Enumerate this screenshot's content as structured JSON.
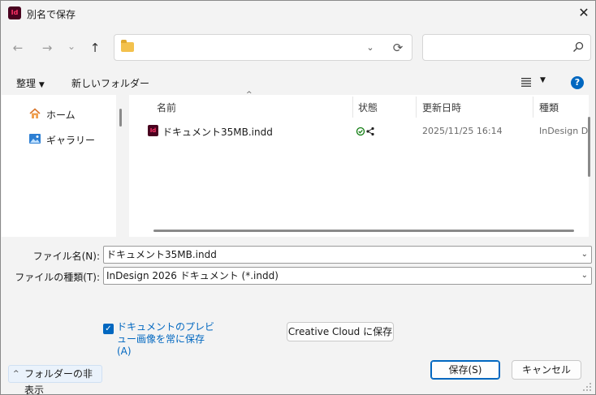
{
  "window": {
    "title": "別名で保存",
    "app_icon": "Id",
    "close_glyph": "✕"
  },
  "nav": {
    "back": "←",
    "forward": "→",
    "recent": "⌄",
    "up": "↑",
    "address_chevron": "⌄",
    "refresh": "⟳"
  },
  "toolbar": {
    "organize": "整理",
    "organize_caret": "▼",
    "new_folder": "新しいフォルダー",
    "view_caret": "▼",
    "help": "?"
  },
  "sidebar": {
    "items": [
      {
        "label": "ホーム",
        "icon": "home-icon"
      },
      {
        "label": "ギャラリー",
        "icon": "gallery-icon"
      }
    ]
  },
  "file_list": {
    "sort_glyph": "^",
    "columns": [
      "名前",
      "状態",
      "更新日時",
      "種類"
    ],
    "rows": [
      {
        "icon": "Id",
        "name": "ドキュメント35MB.indd",
        "modified": "2025/11/25 16:14",
        "type": "InDesign D"
      }
    ]
  },
  "form": {
    "filename_label": "ファイル名(N):",
    "filename_value": "ドキュメント35MB.indd",
    "filetype_label": "ファイルの種類(T):",
    "filetype_value": "InDesign 2026 ドキュメント (*.indd)",
    "dropdown_glyph": "⌄"
  },
  "options": {
    "preview_checkbox_checked": true,
    "check_glyph": "✓",
    "preview_label": "ドキュメントのプレビュー画像を常に保存(A)",
    "creative_cloud_button": "Creative Cloud に保存"
  },
  "footer": {
    "hide_folders_chevron": "^",
    "hide_folders": "フォルダーの非表示",
    "save": "保存(S)",
    "cancel": "キャンセル"
  },
  "colors": {
    "accent": "#0067c0",
    "indesign_bg": "#49021f",
    "indesign_fg": "#ff3366",
    "sync_ok": "#0f7b0f"
  }
}
